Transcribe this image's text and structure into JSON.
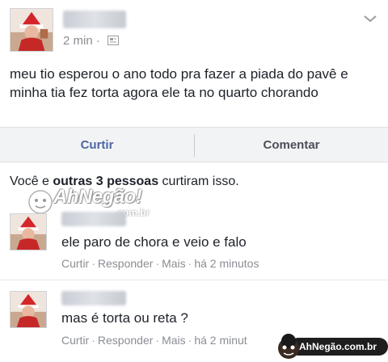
{
  "post": {
    "time": "2 min ·",
    "text": "meu tio esperou o ano todo pra fazer a piada do pavê e minha tia fez torta agora ele ta no quarto chorando"
  },
  "actions": {
    "like_label": "Curtir",
    "comment_label": "Comentar"
  },
  "likes": {
    "prefix": "Você e ",
    "bold": "outras 3 pessoas",
    "suffix": " curtiram isso."
  },
  "comments": [
    {
      "text": "ele paro de chora e veio e falo",
      "like": "Curtir",
      "reply": "Responder",
      "more": "Mais",
      "time": "há 2 minutos"
    },
    {
      "text": "mas é torta ou reta ?",
      "like": "Curtir",
      "reply": "Responder",
      "more": "Mais",
      "time": "há 2 minut"
    }
  ],
  "watermark": {
    "center_text": "AhNegão!",
    "center_sub": ".com.br",
    "badge_text": "AhNegão.com.br"
  },
  "icons": {
    "globe": "globe-icon",
    "chevron": "chevron-down-icon"
  },
  "colors": {
    "link_blue": "#4b67a1",
    "meta_gray": "#8a8d93",
    "bar_bg": "#f2f3f5"
  }
}
